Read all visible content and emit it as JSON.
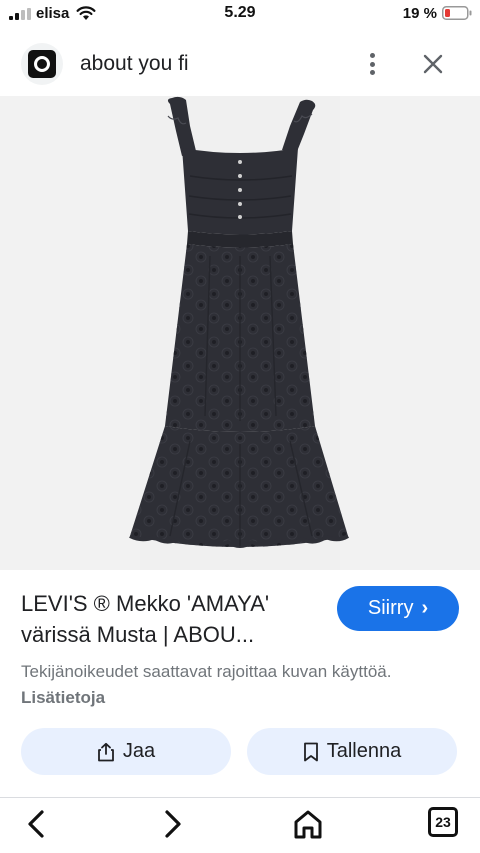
{
  "status_bar": {
    "carrier": "elisa",
    "time": "5.29",
    "battery": "19 %"
  },
  "header": {
    "site": "about you fi"
  },
  "product": {
    "title": "LEVI'S ® Mekko 'AMAYA' värissä Musta | ABOU...",
    "visit_label": "Siirry",
    "copyright_text": "Tekijänoikeudet saattavat rajoittaa kuvan käyttöä.",
    "more_info_label": "Lisätietoja"
  },
  "actions": {
    "share_label": "Jaa",
    "save_label": "Tallenna"
  },
  "bottom_nav": {
    "tab_count": "23"
  },
  "colors": {
    "accent": "#1a73e8",
    "chip_bg": "#e8f0fe",
    "image_bg": "#f2f2f2",
    "dress": "#2e2f36",
    "battery_low": "#e53935"
  },
  "icons": [
    "signal-icon",
    "wifi-icon",
    "battery-icon",
    "site-logo-icon",
    "more-vert-icon",
    "close-icon",
    "share-icon",
    "bookmark-icon",
    "back-arrow-icon",
    "forward-arrow-icon",
    "home-icon",
    "tabs-icon"
  ]
}
